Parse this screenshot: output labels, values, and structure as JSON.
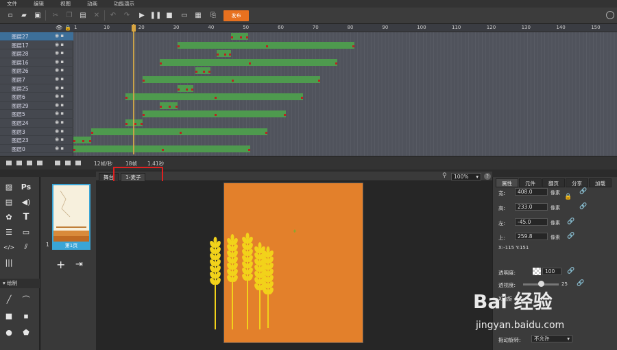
{
  "menu": [
    "文件",
    "编辑",
    "视图",
    "动画",
    "功能演示"
  ],
  "toolbar": {
    "publish_label": "发布",
    "icons": [
      "new-icon",
      "open-icon",
      "save-icon",
      "cut-icon",
      "copy-icon",
      "paste-icon",
      "delete-icon",
      "undo-icon",
      "redo-icon",
      "play-icon",
      "pause-icon",
      "stop-icon",
      "preview-icon",
      "qrcode-icon",
      "export-icon"
    ]
  },
  "timeline": {
    "ruler_ticks": [
      "1",
      "10",
      "20",
      "30",
      "40",
      "50",
      "60",
      "70",
      "80",
      "90",
      "100",
      "110",
      "120",
      "130",
      "140",
      "150"
    ],
    "layers": [
      {
        "name": "图层27",
        "selected": true
      },
      {
        "name": "图层17"
      },
      {
        "name": "图层28"
      },
      {
        "name": "图层16"
      },
      {
        "name": "图层26"
      },
      {
        "name": "图层7"
      },
      {
        "name": "图层25"
      },
      {
        "name": "图层6"
      },
      {
        "name": "图层29"
      },
      {
        "name": "图层5"
      },
      {
        "name": "图层24"
      },
      {
        "name": "图层3"
      },
      {
        "name": "图层23"
      },
      {
        "name": "图层0"
      }
    ],
    "fps_label": "12帧/秒",
    "frame_label": "18帧",
    "time_label": "1.41秒"
  },
  "tabs": {
    "stage": "舞台",
    "object": "1-麦子",
    "zoom": "100%"
  },
  "pages": {
    "thumb_label": "第1页",
    "page_number": "1"
  },
  "tools": {
    "draw_header": "绘制",
    "items": [
      "image-icon",
      "ps-icon",
      "picture-icon",
      "sound-icon",
      "palette-icon",
      "text-icon",
      "paragraph-icon",
      "comment-icon",
      "html-icon",
      "chart-icon",
      "barcode-icon",
      "line-icon",
      "curve-icon",
      "rect-icon",
      "rounded-rect-icon",
      "circle-icon",
      "pentagon-icon"
    ]
  },
  "props": {
    "tabs": [
      "属性",
      "元件",
      "翻页",
      "分享",
      "加载"
    ],
    "width_label": "宽:",
    "width_value": "408.0",
    "height_label": "高:",
    "height_value": "233.0",
    "left_label": "左:",
    "left_value": "-45.0",
    "top_label": "上:",
    "top_value": "259.8",
    "unit": "像素",
    "coords": "X:-115   Y:151",
    "opacity_label": "透明度:",
    "opacity_value": "100",
    "perspective_label": "透视度:",
    "perspective_value": "25",
    "xaxis_label": "X轴旋",
    "drag_label": "拖动旋转:",
    "drag_value": "不允许"
  },
  "watermark": {
    "main": "Bai 经验",
    "sub": "jingyan.baidu.com"
  },
  "colors": {
    "accent": "#e8711f",
    "stage": "#e3802b",
    "tween": "#4e9a4e",
    "selection": "#3aa5d6",
    "highlight": "#e02020"
  }
}
